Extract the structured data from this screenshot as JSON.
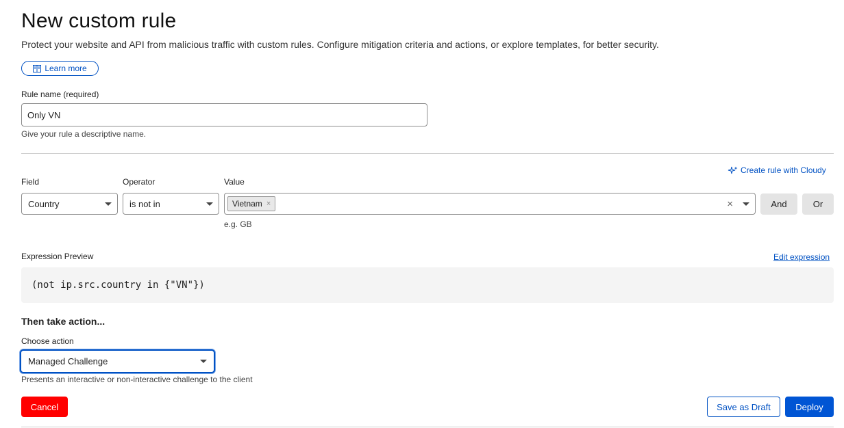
{
  "header": {
    "title": "New custom rule",
    "description": "Protect your website and API from malicious traffic with custom rules. Configure mitigation criteria and actions, or explore templates, for better security.",
    "learn_more_label": "Learn more"
  },
  "rule_name": {
    "label": "Rule name (required)",
    "value": "Only VN",
    "hint": "Give your rule a descriptive name."
  },
  "builder": {
    "cloudy_link": "Create rule with Cloudy",
    "field_label": "Field",
    "operator_label": "Operator",
    "value_label": "Value",
    "field_value": "Country",
    "operator_value": "is not in",
    "value_tags": [
      "Vietnam"
    ],
    "value_hint": "e.g. GB",
    "and_label": "And",
    "or_label": "Or"
  },
  "expression": {
    "label": "Expression Preview",
    "edit_link": "Edit expression",
    "code": "(not ip.src.country in {\"VN\"})"
  },
  "action": {
    "heading": "Then take action...",
    "label": "Choose action",
    "selected": "Managed Challenge",
    "hint": "Presents an interactive or non-interactive challenge to the client"
  },
  "footer": {
    "cancel_label": "Cancel",
    "draft_label": "Save as Draft",
    "deploy_label": "Deploy"
  },
  "colors": {
    "accent": "#0051c3",
    "danger": "#ff0000",
    "primary_button": "#0055d4"
  }
}
